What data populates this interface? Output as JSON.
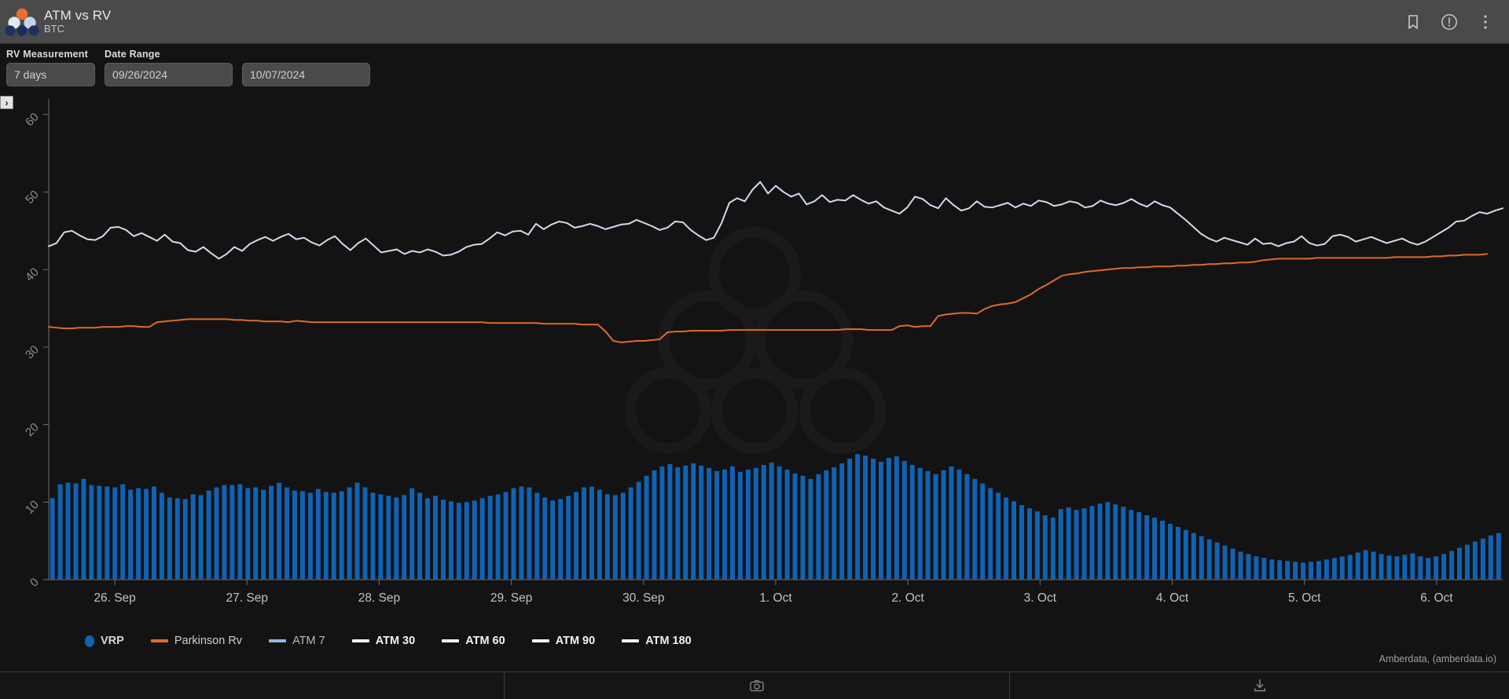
{
  "header": {
    "title": "ATM vs RV",
    "subtitle": "BTC",
    "logo_name": "amberdata-molecule-logo",
    "actions": [
      {
        "name": "bookmark-icon",
        "label": "Bookmark"
      },
      {
        "name": "info-circle-icon",
        "label": "Info"
      },
      {
        "name": "more-vertical-icon",
        "label": "More options"
      }
    ]
  },
  "controls": {
    "rv_measurement_label": "RV Measurement",
    "rv_measurement_value": "7 days",
    "date_range_label": "Date Range",
    "date_start": "09/26/2024",
    "date_end": "10/07/2024",
    "expand_glyph": "›"
  },
  "footer": {
    "credit": "Amberdata, (amberdata.io)",
    "toolbar": [
      {
        "name": "camera-icon",
        "label": "Screenshot"
      },
      {
        "name": "download-icon",
        "label": "Download"
      }
    ]
  },
  "colors": {
    "vrp_bar": "#1262b3",
    "parkinson": "#e06a2b",
    "atm7": "#cfdced",
    "inactive": "#f2f2f2",
    "axis": "#6f6f6f",
    "background": "#131313",
    "titlebar": "#4a4a4a"
  },
  "chart_data": {
    "type": "line",
    "title": "ATM vs RV",
    "subtitle": "BTC",
    "xlabel": "",
    "ylabel": "",
    "grid": false,
    "legend_position": "bottom",
    "ylim": [
      0,
      62
    ],
    "yticks": [
      0,
      10,
      20,
      30,
      40,
      50,
      60
    ],
    "xticks": [
      "26. Sep",
      "27. Sep",
      "28. Sep",
      "29. Sep",
      "30. Sep",
      "1. Oct",
      "2. Oct",
      "3. Oct",
      "4. Oct",
      "5. Oct",
      "6. Oct"
    ],
    "x_range": [
      "09/26/2024",
      "10/07/2024"
    ],
    "legend": [
      {
        "name": "VRP",
        "type": "bar",
        "color": "#1262b3",
        "active": true
      },
      {
        "name": "Parkinson Rv",
        "type": "line",
        "color": "#e06a2b",
        "active": true
      },
      {
        "name": "ATM 7",
        "type": "line",
        "color": "#8fb8e0",
        "active": true
      },
      {
        "name": "ATM 30",
        "type": "line",
        "color": "#f2f2f2",
        "active": false
      },
      {
        "name": "ATM 60",
        "type": "line",
        "color": "#f2f2f2",
        "active": false
      },
      {
        "name": "ATM 90",
        "type": "line",
        "color": "#f2f2f2",
        "active": false
      },
      {
        "name": "ATM 180",
        "type": "line",
        "color": "#f2f2f2",
        "active": false
      }
    ],
    "series": [
      {
        "name": "ATM 7",
        "type": "line",
        "color": "#cfdced",
        "values": [
          43.0,
          43.4,
          44.8,
          45.0,
          44.4,
          43.9,
          43.8,
          44.3,
          45.4,
          45.5,
          45.1,
          44.3,
          44.7,
          44.2,
          43.7,
          44.5,
          43.6,
          43.4,
          42.5,
          42.3,
          42.9,
          42.1,
          41.4,
          42.0,
          42.9,
          42.4,
          43.3,
          43.8,
          44.2,
          43.7,
          44.2,
          44.6,
          43.9,
          44.1,
          43.5,
          43.1,
          43.8,
          44.3,
          43.3,
          42.5,
          43.4,
          44.0,
          43.1,
          42.2,
          42.4,
          42.6,
          42.0,
          42.4,
          42.2,
          42.6,
          42.3,
          41.8,
          41.9,
          42.3,
          42.9,
          43.2,
          43.3,
          44.0,
          44.8,
          44.4,
          44.9,
          45.0,
          44.5,
          45.9,
          45.2,
          45.8,
          46.2,
          46.0,
          45.4,
          45.6,
          45.9,
          45.6,
          45.2,
          45.5,
          45.8,
          45.9,
          46.4,
          46.0,
          45.6,
          45.1,
          45.4,
          46.2,
          46.1,
          45.1,
          44.4,
          43.8,
          44.1,
          46.0,
          48.6,
          49.2,
          48.8,
          50.3,
          51.3,
          49.8,
          50.8,
          50.0,
          49.4,
          49.8,
          48.4,
          48.8,
          49.6,
          48.7,
          49.0,
          48.9,
          49.6,
          49.0,
          48.5,
          48.8,
          48.0,
          47.6,
          47.2,
          48.0,
          49.4,
          49.1,
          48.3,
          47.9,
          49.2,
          48.3,
          47.6,
          47.9,
          48.8,
          48.1,
          48.0,
          48.3,
          48.6,
          48.0,
          48.5,
          48.2,
          48.9,
          48.7,
          48.2,
          48.4,
          48.8,
          48.6,
          48.0,
          48.2,
          48.9,
          48.5,
          48.3,
          48.6,
          49.1,
          48.5,
          48.1,
          48.8,
          48.3,
          48.0,
          47.2,
          46.4,
          45.5,
          44.6,
          44.0,
          43.6,
          44.1,
          43.8,
          43.5,
          43.2,
          44.0,
          43.3,
          43.4,
          43.0,
          43.4,
          43.6,
          44.3,
          43.4,
          43.1,
          43.3,
          44.3,
          44.5,
          44.2,
          43.6,
          43.9,
          44.2,
          43.8,
          43.4,
          43.7,
          44.0,
          43.5,
          43.2,
          43.6,
          44.2,
          44.8,
          45.4,
          46.2,
          46.3,
          46.9,
          47.4,
          47.2,
          47.6,
          47.9
        ]
      },
      {
        "name": "Parkinson Rv",
        "type": "line",
        "color": "#e06a2b",
        "values": [
          32.6,
          32.5,
          32.4,
          32.4,
          32.5,
          32.5,
          32.5,
          32.6,
          32.6,
          32.6,
          32.7,
          32.7,
          32.6,
          32.6,
          33.2,
          33.3,
          33.4,
          33.5,
          33.6,
          33.6,
          33.6,
          33.6,
          33.6,
          33.6,
          33.5,
          33.5,
          33.4,
          33.4,
          33.3,
          33.3,
          33.3,
          33.2,
          33.4,
          33.3,
          33.2,
          33.2,
          33.2,
          33.2,
          33.2,
          33.2,
          33.2,
          33.2,
          33.2,
          33.2,
          33.2,
          33.2,
          33.2,
          33.2,
          33.2,
          33.2,
          33.2,
          33.2,
          33.2,
          33.2,
          33.2,
          33.2,
          33.2,
          33.1,
          33.1,
          33.1,
          33.1,
          33.1,
          33.1,
          33.1,
          33.0,
          33.0,
          33.0,
          33.0,
          33.0,
          32.9,
          32.9,
          32.9,
          32.0,
          30.8,
          30.6,
          30.7,
          30.8,
          30.8,
          30.9,
          31.0,
          31.9,
          32.0,
          32.0,
          32.1,
          32.1,
          32.1,
          32.1,
          32.1,
          32.2,
          32.2,
          32.2,
          32.2,
          32.2,
          32.2,
          32.2,
          32.2,
          32.2,
          32.2,
          32.2,
          32.2,
          32.2,
          32.2,
          32.2,
          32.3,
          32.3,
          32.3,
          32.2,
          32.2,
          32.2,
          32.2,
          32.7,
          32.8,
          32.6,
          32.7,
          32.7,
          34.0,
          34.2,
          34.3,
          34.4,
          34.4,
          34.3,
          34.9,
          35.3,
          35.5,
          35.6,
          35.8,
          36.3,
          36.8,
          37.5,
          38.0,
          38.6,
          39.2,
          39.4,
          39.5,
          39.7,
          39.8,
          39.9,
          40.0,
          40.1,
          40.2,
          40.2,
          40.3,
          40.3,
          40.4,
          40.4,
          40.4,
          40.5,
          40.5,
          40.6,
          40.6,
          40.7,
          40.7,
          40.8,
          40.8,
          40.9,
          40.9,
          41.0,
          41.2,
          41.3,
          41.4,
          41.4,
          41.4,
          41.4,
          41.4,
          41.5,
          41.5,
          41.5,
          41.5,
          41.5,
          41.5,
          41.5,
          41.5,
          41.5,
          41.5,
          41.6,
          41.6,
          41.6,
          41.6,
          41.6,
          41.7,
          41.7,
          41.8,
          41.8,
          41.9,
          41.9,
          41.9,
          42.0
        ]
      },
      {
        "name": "VRP",
        "type": "bar",
        "color": "#1262b3",
        "values": [
          10.5,
          12.3,
          12.5,
          12.4,
          13.0,
          12.2,
          12.1,
          12.0,
          11.9,
          12.3,
          11.6,
          11.8,
          11.7,
          12.0,
          11.2,
          10.6,
          10.5,
          10.4,
          11.0,
          10.9,
          11.5,
          11.9,
          12.2,
          12.2,
          12.3,
          11.8,
          11.9,
          11.6,
          12.1,
          12.5,
          11.9,
          11.5,
          11.4,
          11.2,
          11.7,
          11.3,
          11.2,
          11.4,
          11.9,
          12.5,
          11.9,
          11.2,
          11.0,
          10.8,
          10.6,
          10.9,
          11.8,
          11.2,
          10.5,
          10.8,
          10.3,
          10.1,
          9.9,
          10.0,
          10.2,
          10.5,
          10.8,
          11.0,
          11.3,
          11.8,
          12.0,
          11.9,
          11.2,
          10.6,
          10.2,
          10.4,
          10.8,
          11.3,
          11.9,
          12.0,
          11.6,
          11.0,
          10.9,
          11.2,
          11.9,
          12.6,
          13.4,
          14.1,
          14.6,
          14.9,
          14.5,
          14.7,
          15.0,
          14.7,
          14.4,
          14.0,
          14.2,
          14.6,
          13.9,
          14.2,
          14.4,
          14.8,
          15.1,
          14.6,
          14.2,
          13.7,
          13.4,
          13.0,
          13.6,
          14.1,
          14.5,
          15.0,
          15.6,
          16.2,
          16.0,
          15.6,
          15.2,
          15.7,
          15.9,
          15.3,
          14.8,
          14.4,
          14.0,
          13.6,
          14.1,
          14.6,
          14.2,
          13.6,
          13.0,
          12.4,
          11.8,
          11.2,
          10.6,
          10.1,
          9.6,
          9.2,
          8.8,
          8.3,
          8.0,
          9.1,
          9.3,
          9.0,
          9.2,
          9.5,
          9.8,
          10.0,
          9.7,
          9.4,
          9.0,
          8.7,
          8.3,
          8.0,
          7.6,
          7.2,
          6.8,
          6.4,
          6.0,
          5.6,
          5.2,
          4.8,
          4.4,
          4.0,
          3.6,
          3.3,
          3.0,
          2.8,
          2.6,
          2.5,
          2.4,
          2.3,
          2.2,
          2.3,
          2.4,
          2.6,
          2.8,
          3.0,
          3.2,
          3.5,
          3.8,
          3.6,
          3.3,
          3.1,
          3.0,
          3.2,
          3.4,
          3.0,
          2.8,
          3.0,
          3.3,
          3.7,
          4.1,
          4.5,
          4.9,
          5.3,
          5.7,
          6.0
        ]
      }
    ]
  }
}
